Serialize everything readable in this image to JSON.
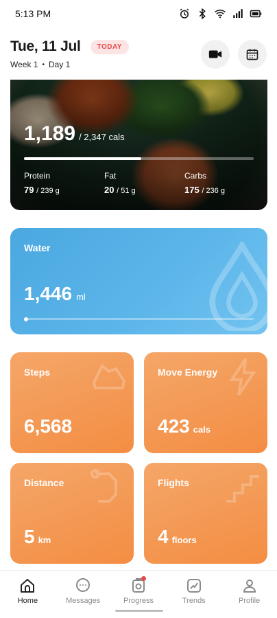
{
  "status_bar": {
    "time": "5:13 PM"
  },
  "header": {
    "date": "Tue, 11 Jul",
    "badge": "TODAY",
    "week": "Week 1",
    "day": "Day 1",
    "separator": "•"
  },
  "calories": {
    "consumed": "1,189",
    "goal": "/ 2,347 cals",
    "progress": 0.51,
    "macros": [
      {
        "label": "Protein",
        "value": "79",
        "goal": "/ 239 g"
      },
      {
        "label": "Fat",
        "value": "20",
        "goal": "/ 51 g"
      },
      {
        "label": "Carbs",
        "value": "175",
        "goal": "/ 236 g"
      }
    ]
  },
  "water": {
    "title": "Water",
    "value": "1,446",
    "unit": "ml",
    "progress": 0.0
  },
  "tiles": {
    "steps": {
      "title": "Steps",
      "value": "6,568",
      "unit": ""
    },
    "energy": {
      "title": "Move Energy",
      "value": "423",
      "unit": "cals"
    },
    "distance": {
      "title": "Distance",
      "value": "5",
      "unit": "km"
    },
    "flights": {
      "title": "Flights",
      "value": "4",
      "unit": "floors"
    }
  },
  "nav": [
    {
      "label": "Home",
      "icon": "home-icon",
      "active": true
    },
    {
      "label": "Messages",
      "icon": "messages-icon",
      "active": false
    },
    {
      "label": "Progress",
      "icon": "camera-icon",
      "active": false,
      "notification": true
    },
    {
      "label": "Trends",
      "icon": "trends-icon",
      "active": false
    },
    {
      "label": "Profile",
      "icon": "profile-icon",
      "active": false
    }
  ],
  "colors": {
    "water": "#5db6ea",
    "tile_orange": "#f39a56",
    "badge_red": "#e34a4a"
  }
}
